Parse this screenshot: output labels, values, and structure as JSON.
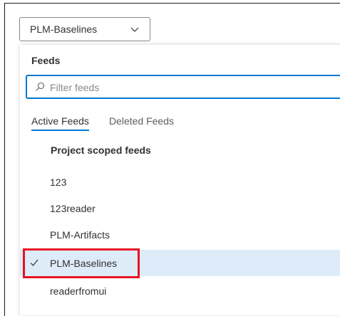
{
  "feed_selector": {
    "selected_label": "PLM-Baselines",
    "icon": "chevron-down-icon"
  },
  "panel": {
    "title": "Feeds",
    "search": {
      "placeholder": "Filter feeds",
      "value": "",
      "icon": "search-icon"
    },
    "tabs": [
      {
        "label": "Active Feeds",
        "active": true
      },
      {
        "label": "Deleted Feeds",
        "active": false
      }
    ],
    "group_header": "Project scoped feeds",
    "items": [
      {
        "label": "123",
        "selected": false
      },
      {
        "label": "123reader",
        "selected": false
      },
      {
        "label": "PLM-Artifacts",
        "selected": false
      },
      {
        "label": "PLM-Baselines",
        "selected": true,
        "icon": "checkmark-icon"
      },
      {
        "label": "readerfromui",
        "selected": false
      }
    ]
  },
  "colors": {
    "accent": "#0078d4",
    "selected_background": "#deecf9",
    "annotation_highlight": "#e81123"
  }
}
